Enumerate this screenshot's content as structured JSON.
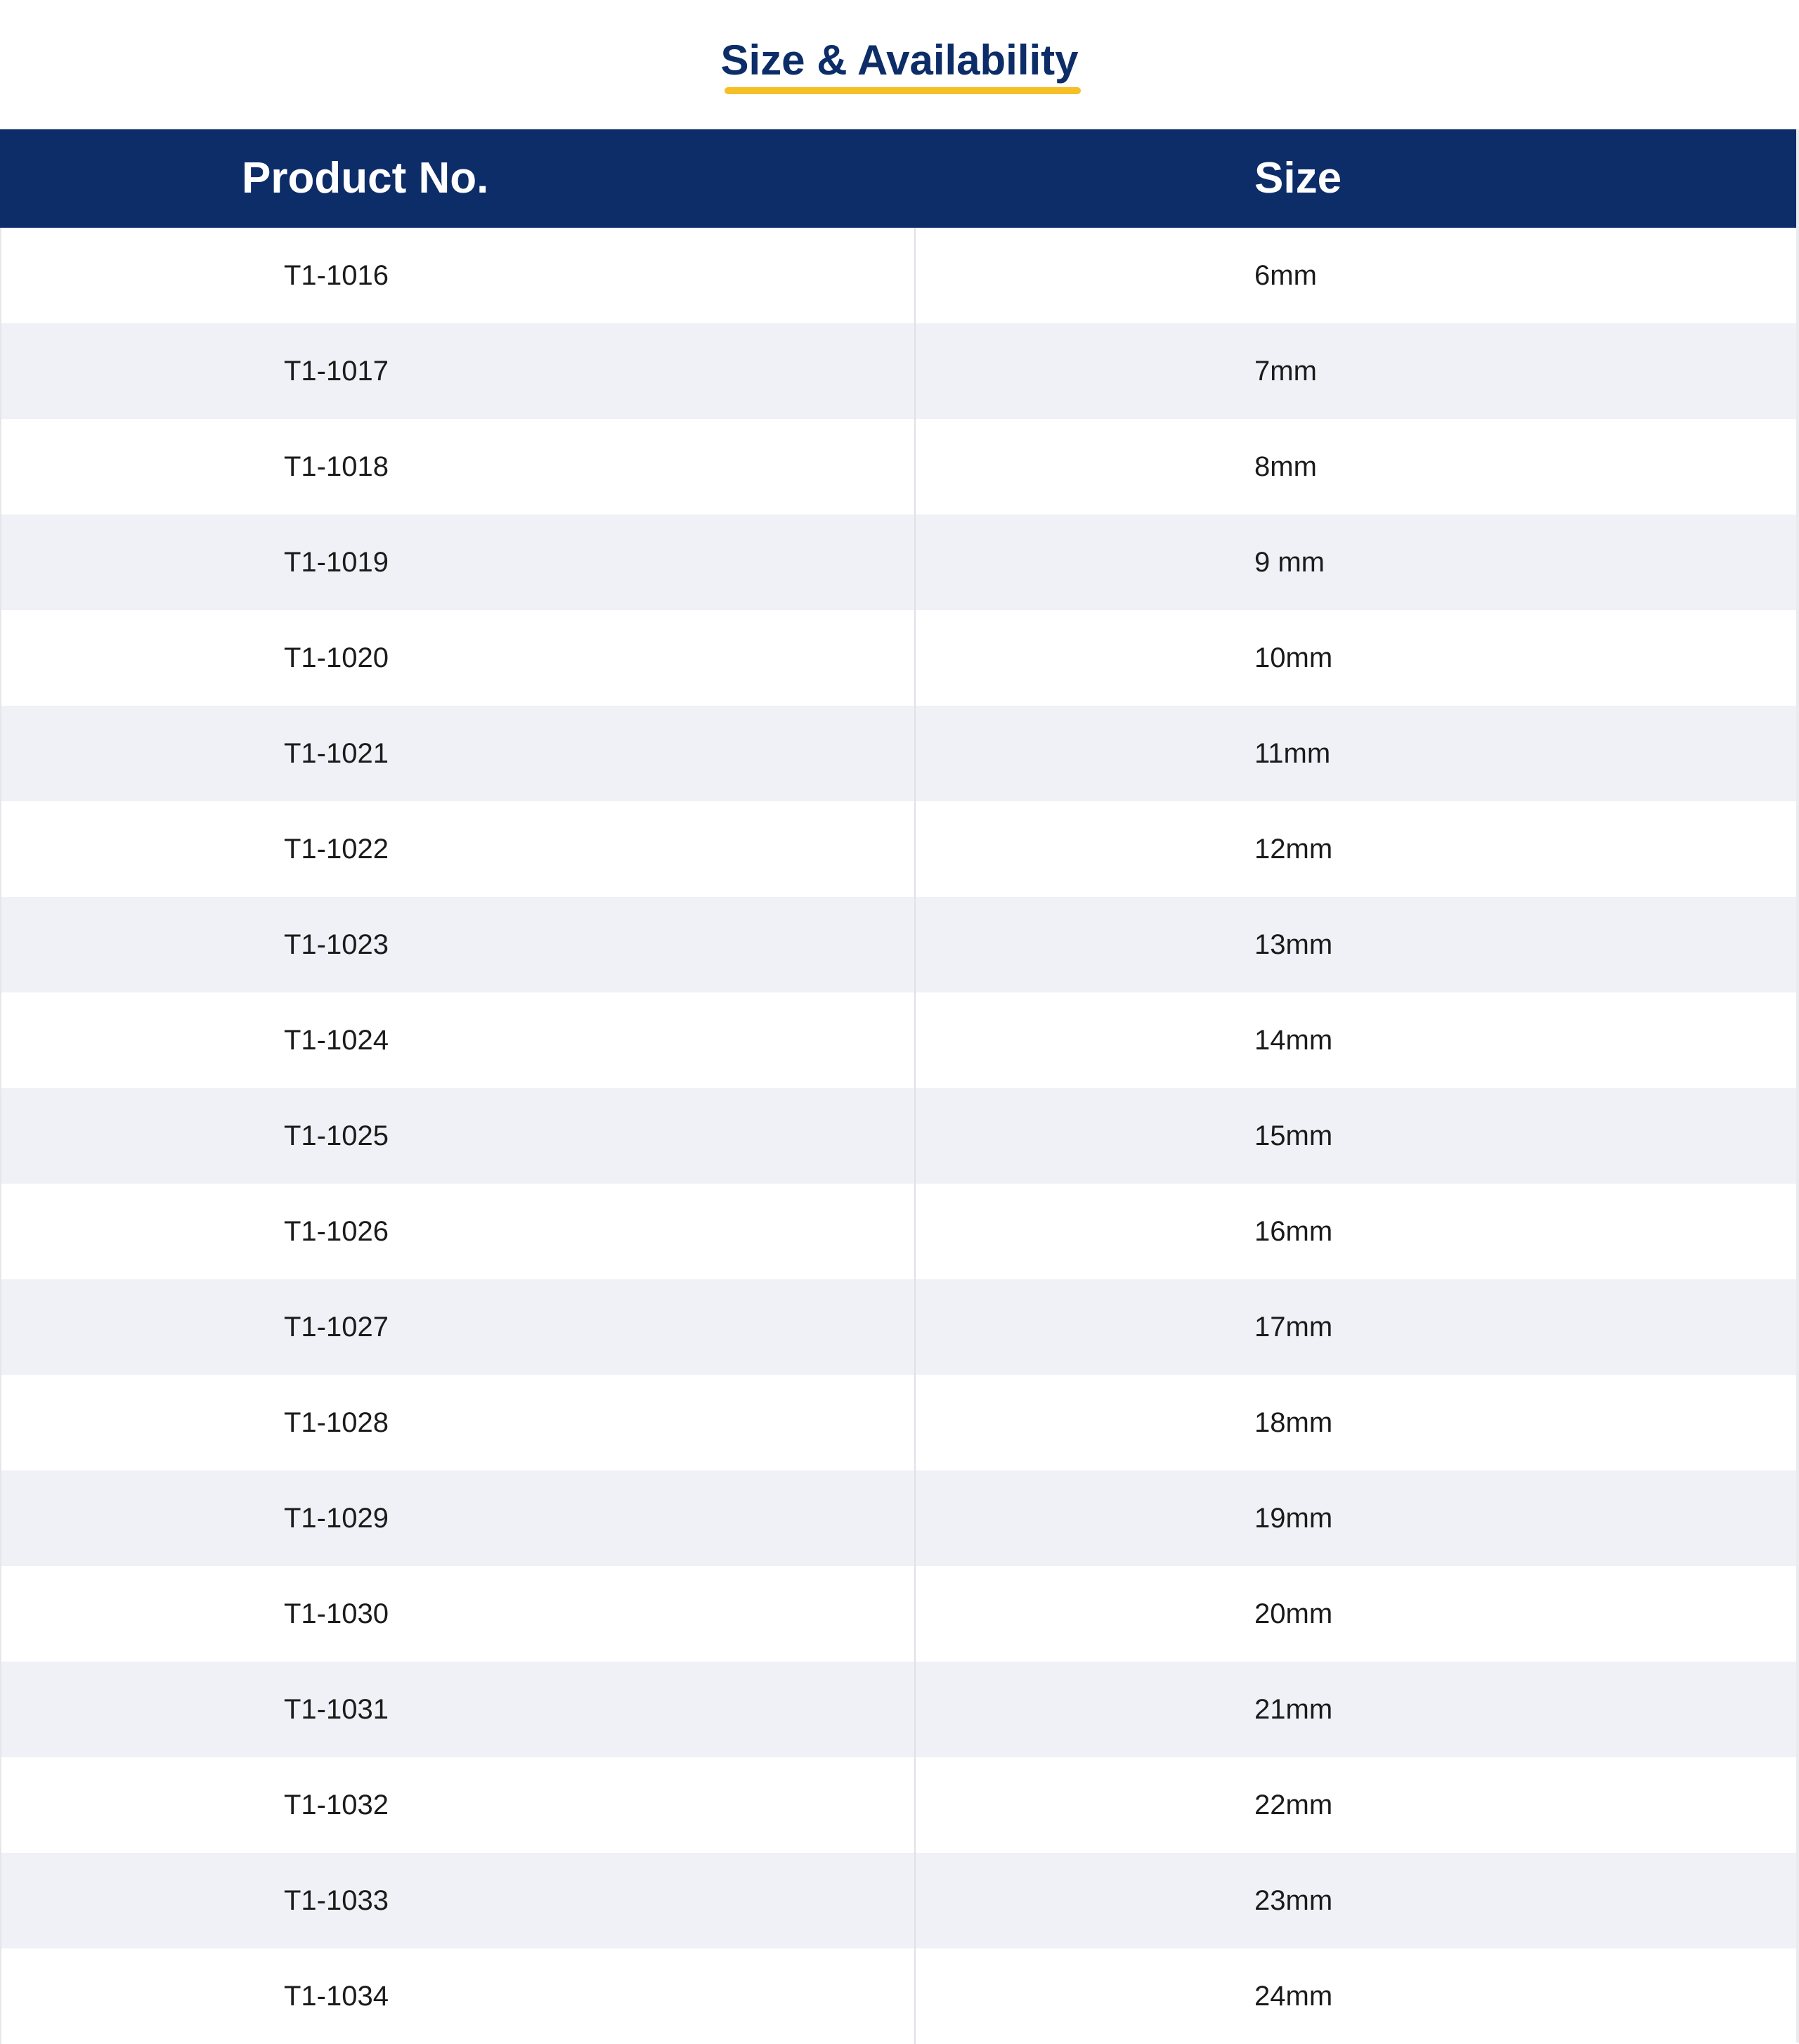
{
  "page": {
    "title": "Size & Availability"
  },
  "colors": {
    "primary_navy": "#0d2d68",
    "accent_yellow": "#f6bf26",
    "row_alt": "#f0f1f6",
    "text": "#1b1b1b"
  },
  "table": {
    "headers": [
      "Product No.",
      "Size"
    ],
    "rows": [
      {
        "product": "T1-1016",
        "size": "6mm"
      },
      {
        "product": "T1-1017",
        "size": "7mm"
      },
      {
        "product": "T1-1018",
        "size": "8mm"
      },
      {
        "product": "T1-1019",
        "size": "9 mm"
      },
      {
        "product": "T1-1020",
        "size": "10mm"
      },
      {
        "product": "T1-1021",
        "size": "11mm"
      },
      {
        "product": "T1-1022",
        "size": "12mm"
      },
      {
        "product": "T1-1023",
        "size": "13mm"
      },
      {
        "product": "T1-1024",
        "size": "14mm"
      },
      {
        "product": "T1-1025",
        "size": "15mm"
      },
      {
        "product": "T1-1026",
        "size": "16mm"
      },
      {
        "product": "T1-1027",
        "size": "17mm"
      },
      {
        "product": "T1-1028",
        "size": "18mm"
      },
      {
        "product": "T1-1029",
        "size": "19mm"
      },
      {
        "product": "T1-1030",
        "size": "20mm"
      },
      {
        "product": "T1-1031",
        "size": "21mm"
      },
      {
        "product": "T1-1032",
        "size": "22mm"
      },
      {
        "product": "T1-1033",
        "size": "23mm"
      },
      {
        "product": "T1-1034",
        "size": "24mm"
      }
    ]
  }
}
